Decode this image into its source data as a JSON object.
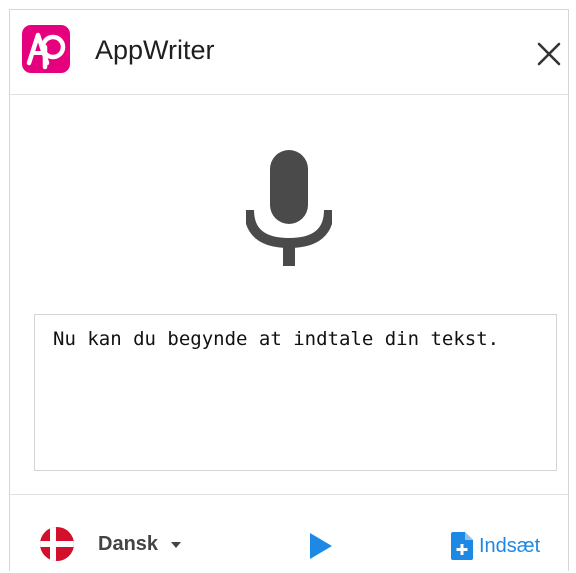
{
  "header": {
    "app_title": "AppWriter",
    "logo_icon": "appwriter-logo",
    "close_icon": "close-icon",
    "brand_color": "#e6007e"
  },
  "main": {
    "mic_icon": "microphone-icon",
    "text_content": "Nu kan du begynde at indtale din tekst."
  },
  "footer": {
    "language_label": "Dansk",
    "language_flag": "denmark-flag-icon",
    "dropdown_icon": "caret-down-icon",
    "play_icon": "play-icon",
    "insert_label": "Indsæt",
    "insert_icon": "insert-document-icon",
    "accent_color": "#1e88e5"
  }
}
